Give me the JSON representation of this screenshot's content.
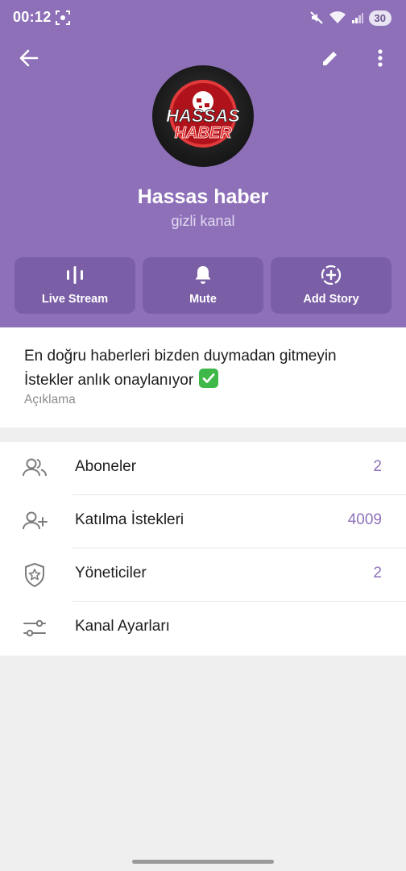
{
  "status_bar": {
    "time": "00:12",
    "battery": "30"
  },
  "profile": {
    "logo_text_line1": "HASSAS",
    "logo_text_line2": "HABER",
    "name": "Hassas haber",
    "subtitle": "gizli kanal"
  },
  "actions": [
    {
      "label": "Live Stream",
      "icon": "live-stream-icon"
    },
    {
      "label": "Mute",
      "icon": "bell-icon"
    },
    {
      "label": "Add Story",
      "icon": "add-story-icon"
    }
  ],
  "description": {
    "line1": "En doğru haberleri bizden duymadan gitmeyin",
    "line2": "İstekler anlık onaylanıyor",
    "caption": "Açıklama"
  },
  "menu": [
    {
      "label": "Aboneler",
      "value": "2",
      "icon": "subscribers-icon"
    },
    {
      "label": "Katılma İstekleri",
      "value": "4009",
      "icon": "add-user-icon"
    },
    {
      "label": "Yöneticiler",
      "value": "2",
      "icon": "admin-shield-icon"
    },
    {
      "label": "Kanal Ayarları",
      "value": "",
      "icon": "settings-sliders-icon"
    }
  ],
  "colors": {
    "header": "#8e70b9",
    "button": "#7a5ea6",
    "accent": "#8e70b9"
  }
}
